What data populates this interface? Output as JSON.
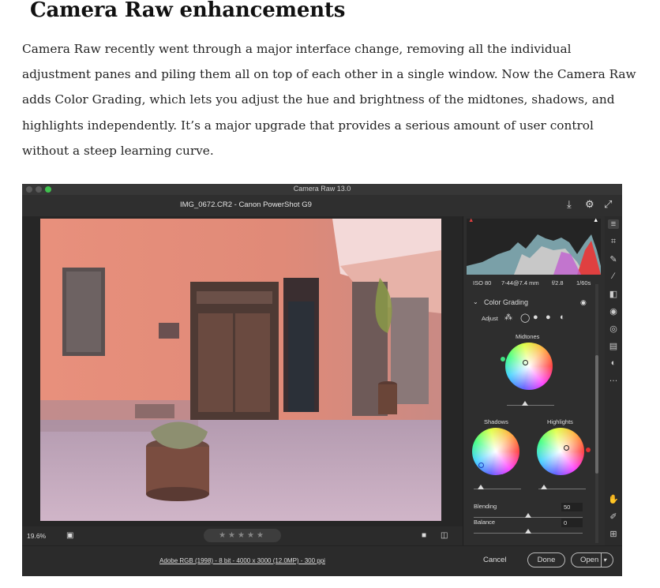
{
  "article": {
    "title": "Camera Raw enhancements",
    "body": "Camera Raw recently went through a major interface change, removing all the individual adjustment panes and piling them all on top of each other in a single window. Now the Camera Raw adds Color Grading, which lets you adjust the hue and brightness of the midtones, shadows, and highlights independently. It’s a major upgrade that provides a serious amount of user control without a steep learning curve."
  },
  "app": {
    "window_title": "Camera Raw 13.0",
    "file_info": "IMG_0672.CR2  -  Canon PowerShot G9",
    "zoom": "19.6%",
    "rating_stars": "★★★★★",
    "workflow_options": "Adobe RGB (1998) - 8 bit - 4000 x 3000 (12.0MP) - 300 ppi",
    "buttons": {
      "cancel": "Cancel",
      "done": "Done",
      "open": "Open"
    }
  },
  "panel": {
    "exif": {
      "iso": "ISO 80",
      "focal": "7-44@7.4 mm",
      "aperture": "f/2.8",
      "shutter": "1/60s"
    },
    "section": "Color Grading",
    "adjust_label": "Adjust",
    "midtones": "Midtones",
    "shadows": "Shadows",
    "highlights": "Highlights",
    "blending_label": "Blending",
    "blending_value": "50",
    "balance_label": "Balance",
    "balance_value": "0"
  },
  "icons": [
    "save-icon",
    "gear-icon",
    "expand-icon",
    "sliders-icon",
    "crop-icon",
    "heal-icon",
    "brush-icon",
    "gradient-icon",
    "radial-icon",
    "redeye-icon",
    "presets-icon",
    "snapshots-icon",
    "more-icon",
    "hand-icon",
    "eyedropper-icon",
    "grid-icon"
  ]
}
